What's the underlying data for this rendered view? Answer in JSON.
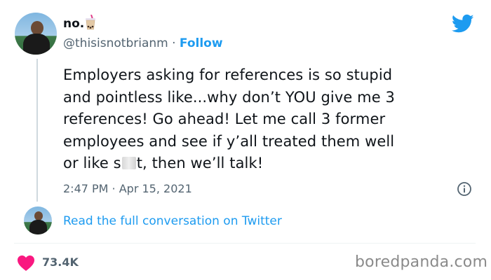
{
  "author": {
    "display_name": "no.",
    "handle": "@thisisnotbrianm",
    "separator": " · ",
    "follow_label": "Follow"
  },
  "tweet": {
    "lines": {
      "l1": "Employers asking for references is so stupid",
      "l2": "and pointless like...why don’t YOU give me 3",
      "l3": "references! Go ahead! Let me call 3 former",
      "l4": "employees and see if y’all treated them well",
      "l5_before": "or like s",
      "l5_after": "t, then we’ll talk!"
    },
    "time": "2:47 PM",
    "date_separator": " · ",
    "date": "Apr 15, 2021"
  },
  "conversation_link": "Read the full conversation on Twitter",
  "likes_count": "73.4K",
  "watermark": "boredpanda.com",
  "icons": {
    "brand": "twitter-bird-icon",
    "emoji": "bubble-tea-icon",
    "info": "info-icon",
    "like": "heart-icon"
  },
  "colors": {
    "accent": "#1d9bf0",
    "secondary_text": "#536471",
    "like": "#f91880",
    "text": "#0f1419"
  }
}
